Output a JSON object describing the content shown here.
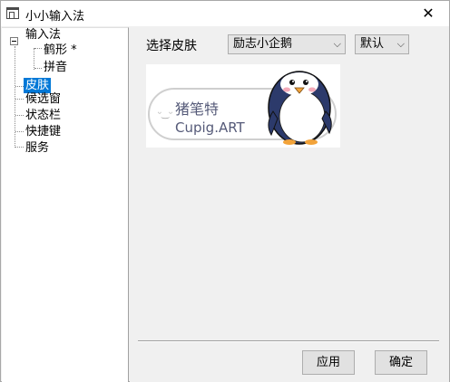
{
  "window": {
    "title": "小小输入法",
    "close_glyph": "✕"
  },
  "sidebar": {
    "items": [
      {
        "label": "输入法"
      },
      {
        "label": "鹤形 *"
      },
      {
        "label": "拼音"
      },
      {
        "label": "皮肤",
        "selected": true
      },
      {
        "label": "候选窗"
      },
      {
        "label": "状态栏"
      },
      {
        "label": "快捷键"
      },
      {
        "label": "服务"
      }
    ]
  },
  "skin": {
    "label": "选择皮肤",
    "skin_select_value": "励志小企鹅",
    "variant_select_value": "默认",
    "dropdown_glyph": "⌵"
  },
  "preview": {
    "line1": "猪笔特",
    "line2": "Cupig.ART",
    "smiley": "ᵕ‿ᵕ"
  },
  "buttons": {
    "apply": "应用",
    "ok": "确定"
  },
  "colors": {
    "selection": "#0078d7",
    "preview_text": "#555a78",
    "penguin_dark": "#2c3a6b",
    "penguin_beak": "#f2a33a"
  }
}
